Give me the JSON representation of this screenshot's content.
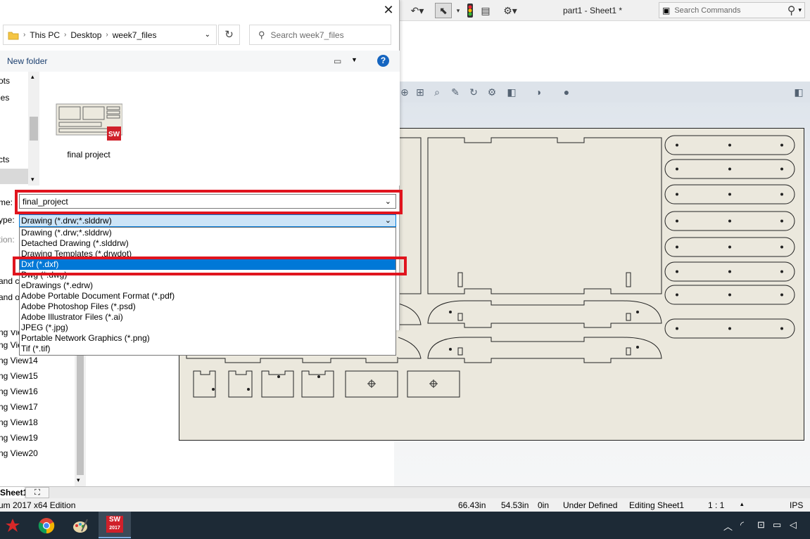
{
  "dialog": {
    "breadcrumb": [
      "This PC",
      "Desktop",
      "week7_files"
    ],
    "search_placeholder": "Search week7_files",
    "new_folder": "New folder",
    "help": "?",
    "nav_items": [
      "ots",
      "les",
      "cts"
    ],
    "file": {
      "name": "final project",
      "badge": "SW"
    },
    "filename_label": "me:",
    "filename_value": "final_project",
    "filetype_label": "ype:",
    "filetype_selected": "Drawing (*.drw;*.slddrw)",
    "description_label": "tion:",
    "truncated_labels": [
      "and c",
      "and o"
    ],
    "filetype_options": [
      "Drawing (*.drw;*.slddrw)",
      "Detached Drawing (*.slddrw)",
      "Drawing Templates (*.drwdot)",
      "Dxf (*.dxf)",
      "Dwg (*.dwg)",
      "eDrawings (*.edrw)",
      "Adobe Portable Document Format (*.pdf)",
      "Adobe Photoshop Files (*.psd)",
      "Adobe Illustrator Files (*.ai)",
      "JPEG (*.jpg)",
      "Portable Network Graphics (*.png)",
      "Tif (*.tif)"
    ],
    "highlighted_option_index": 3
  },
  "solidworks": {
    "doc_title": "part1 - Sheet1 *",
    "search_placeholder": "Search Commands",
    "tree_items": [
      "ng Vie",
      "ng View13",
      "ng View14",
      "ng View15",
      "ng View16",
      "ng View17",
      "ng View18",
      "ng View19",
      "ng View20"
    ],
    "sheet_tab": "Sheet1",
    "status": {
      "edition": "um 2017 x64 Edition",
      "x": "66.43in",
      "y": "54.53in",
      "z": "0in",
      "state": "Under Defined",
      "mode": "Editing Sheet1",
      "scale": "1 : 1",
      "units": "IPS"
    }
  },
  "taskbar": {
    "sw_label": "SW",
    "sw_year": "2017"
  },
  "colors": {
    "highlight": "#e0141e",
    "selection": "#0078d7",
    "sheet": "#ebe8dd"
  }
}
